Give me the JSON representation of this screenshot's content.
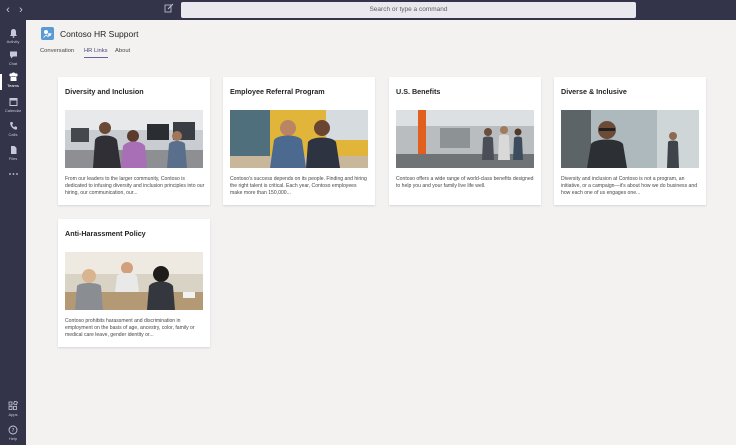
{
  "search": {
    "placeholder": "Search or type a command"
  },
  "rail": [
    {
      "label": "Activity",
      "icon": "bell-icon"
    },
    {
      "label": "Chat",
      "icon": "chat-icon"
    },
    {
      "label": "Teams",
      "icon": "teams-icon",
      "active": true
    },
    {
      "label": "Calendar",
      "icon": "calendar-icon"
    },
    {
      "label": "Calls",
      "icon": "phone-icon"
    },
    {
      "label": "Files",
      "icon": "files-icon"
    },
    {
      "label": "",
      "icon": "more-icon"
    },
    {
      "label": "Apps",
      "icon": "apps-icon"
    },
    {
      "label": "Help",
      "icon": "help-icon"
    }
  ],
  "team": {
    "title": "Contoso HR Support"
  },
  "tabs": [
    {
      "label": "Conversation"
    },
    {
      "label": "HR Links",
      "active": true
    },
    {
      "label": "About"
    }
  ],
  "cards": [
    {
      "title": "Diversity and Inclusion",
      "description": "From our leaders to the larger community, Contoso is dedicated to infusing diversity and inclusion principles into our hiring, our communication, our..."
    },
    {
      "title": "Employee Referral Program",
      "description": "Contoso's success depends on its people. Finding and hiring the right talent is critical. Each year, Contoso employees make more than 150,000..."
    },
    {
      "title": "U.S. Benefits",
      "description": "Contoso offers a wide range of world-class benefits designed to help you and your family live life well."
    },
    {
      "title": "Diverse & Inclusive",
      "description": "Diversity and inclusion at Contoso is not a program, an initiative, or a campaign—it's about how we do business and how each one of us engages one..."
    },
    {
      "title": "Anti-Harassment Policy",
      "description": "Contoso prohibits harassment and discrimination in employment on the basis of age, ancestry, color, family or medical care leave, gender identity or..."
    }
  ],
  "colors": {
    "rail": "#33344a",
    "accent": "#6264a7",
    "background": "#f3f2f1"
  }
}
